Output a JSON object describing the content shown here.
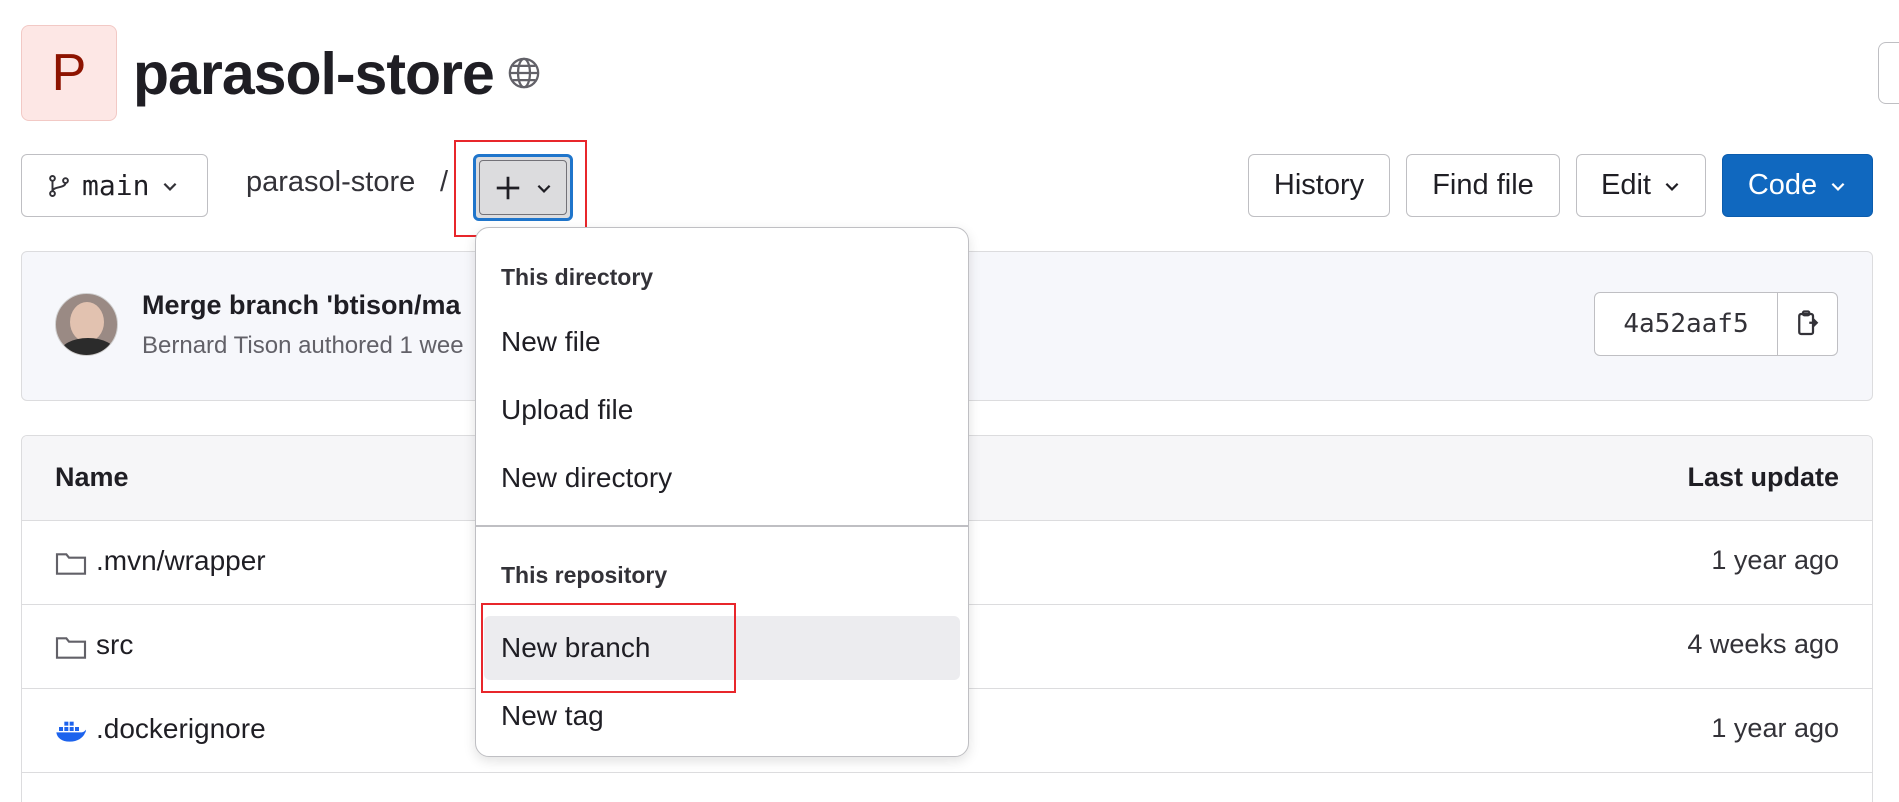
{
  "project": {
    "initial": "P",
    "title": "parasol-store",
    "visibility_icon": "globe-icon"
  },
  "toolbar": {
    "branch": "main",
    "breadcrumb": "parasol-store",
    "separator": "/",
    "plus_label": "+",
    "history_label": "History",
    "find_file_label": "Find file",
    "edit_label": "Edit",
    "code_label": "Code"
  },
  "commit": {
    "message": "Merge branch 'btison/ma",
    "meta": "Bernard Tison authored 1 wee",
    "sha": "4a52aaf5"
  },
  "table": {
    "col_name": "Name",
    "col_last_update": "Last update",
    "rows": [
      {
        "name": ".mvn/wrapper",
        "when": "1 year ago",
        "icon": "folder-icon"
      },
      {
        "name": "src",
        "when": "4 weeks ago",
        "icon": "folder-icon"
      },
      {
        "name": ".dockerignore",
        "when": "1 year ago",
        "icon": "docker-icon"
      }
    ]
  },
  "dropdown": {
    "section1": "This directory",
    "new_file": "New file",
    "upload_file": "Upload file",
    "new_directory": "New directory",
    "section2": "This repository",
    "new_branch": "New branch",
    "new_tag": "New tag"
  },
  "colors": {
    "primary": "#1068bf",
    "highlight": "#e8262b",
    "focus": "#1f75cb"
  }
}
